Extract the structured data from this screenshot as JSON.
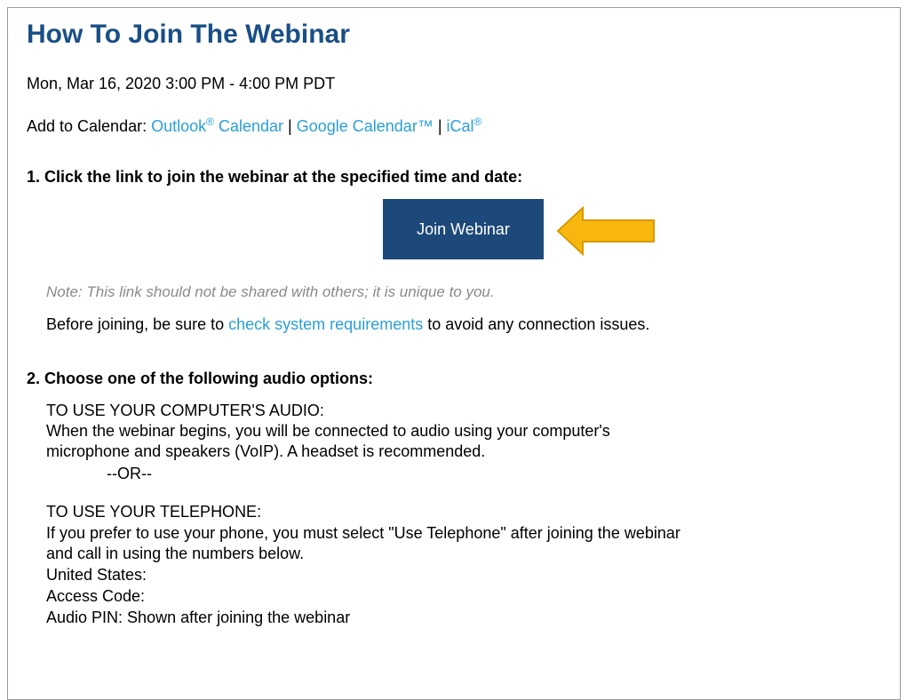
{
  "header": {
    "title": "How To Join The Webinar",
    "datetime": "Mon, Mar 16, 2020 3:00 PM - 4:00 PM PDT"
  },
  "calendar": {
    "prefix": "Add to Calendar: ",
    "outlook_text": "Outlook",
    "outlook_mark": "®",
    "outlook_suffix": " Calendar",
    "separator": " | ",
    "google": "Google Calendar™",
    "ical_text": "iCal",
    "ical_mark": "®"
  },
  "step1": {
    "heading": "1. Click the link to join the webinar at the specified time and date:",
    "button_label": "Join Webinar",
    "note": "Note: This link should not be shared with others; it is unique to you.",
    "before_prefix": "Before joining, be sure to ",
    "before_link": "check system requirements",
    "before_suffix": " to avoid any connection issues."
  },
  "step2": {
    "heading": "2. Choose one of the following audio options:",
    "lines": [
      "TO USE YOUR COMPUTER'S AUDIO:",
      "When the webinar begins, you will be connected to audio using your computer's",
      "microphone and speakers (VoIP). A headset is recommended.",
      "--OR--",
      "TO USE YOUR TELEPHONE:",
      "If you prefer to use your phone, you must select \"Use Telephone\" after joining the webinar",
      "and call in using the numbers below.",
      "United States:",
      "Access Code:",
      "Audio PIN: Shown after joining the webinar"
    ]
  },
  "colors": {
    "title": "#1a4f86",
    "link": "#2a9fd8",
    "button_bg": "#1c4979",
    "arrow_fill": "#f7b70f",
    "arrow_stroke": "#d69a00",
    "note": "#8a8a8a"
  },
  "icons": {
    "arrow": "left-arrow-icon"
  }
}
